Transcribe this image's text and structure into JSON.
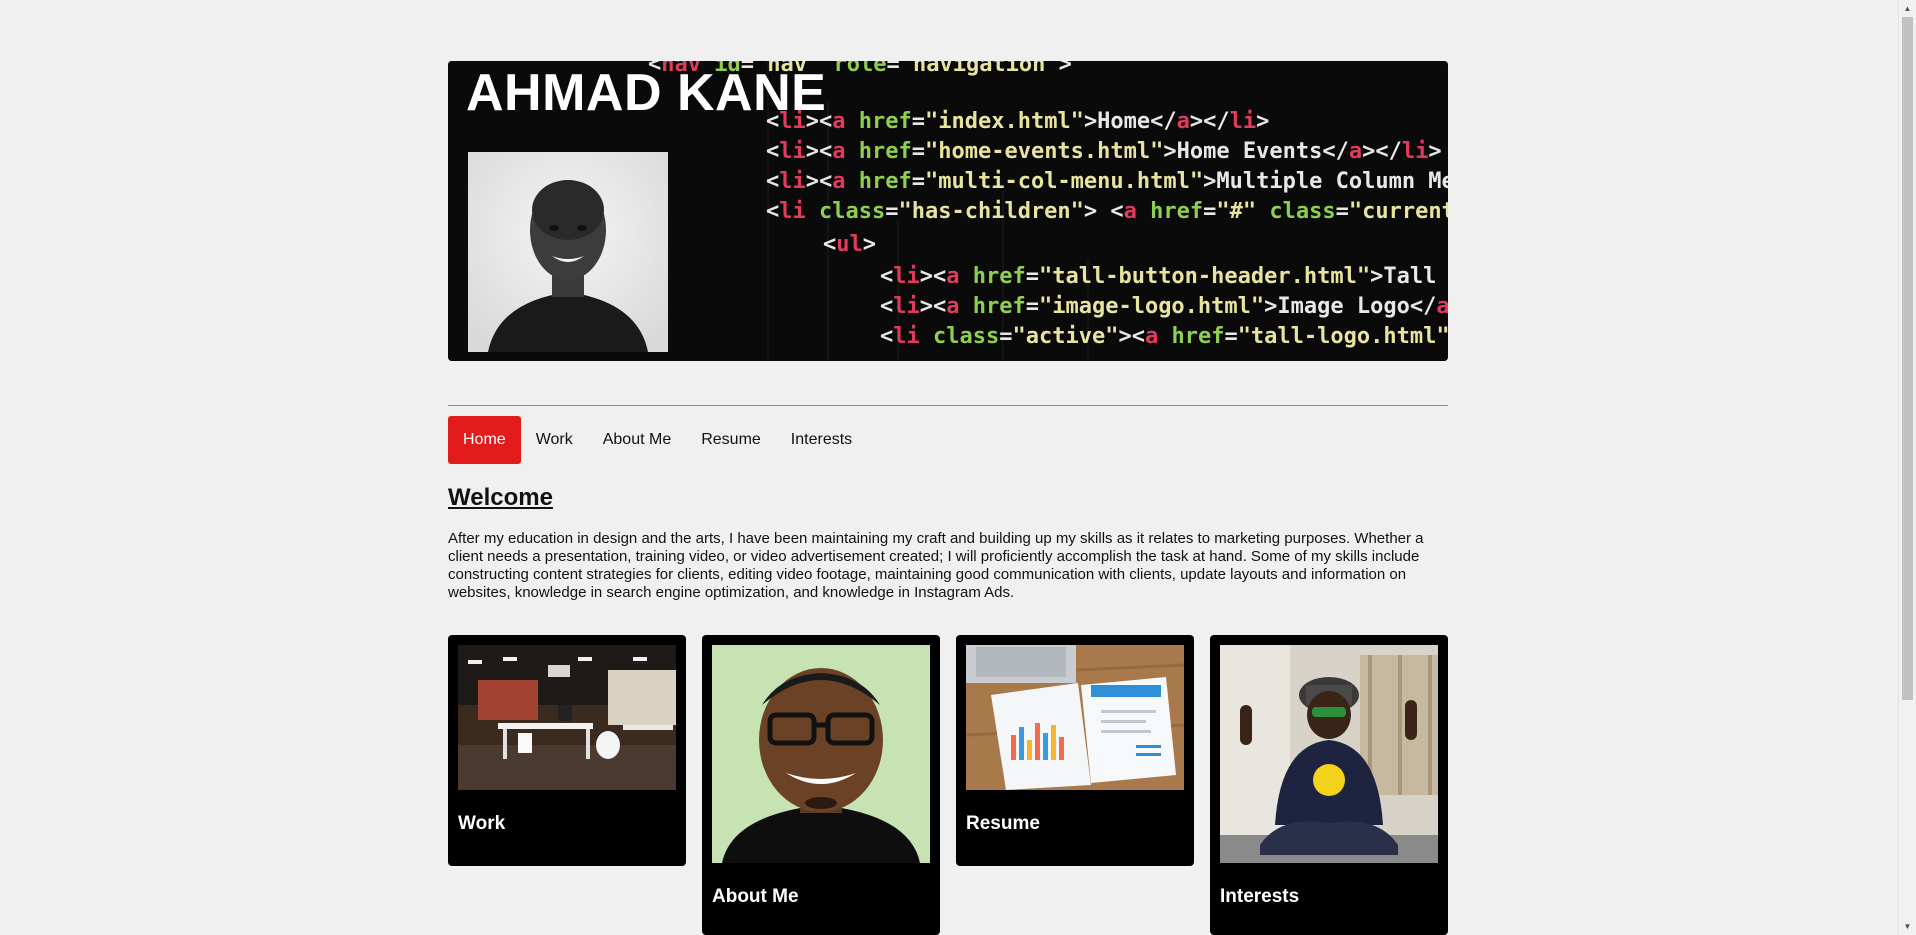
{
  "header": {
    "name": "AHMAD KANE",
    "code_lines": [
      "<nav id=\"nav\" role=\"navigation\">",
      "<li><a href=\"index.html\">Home</a></li>",
      "<li><a href=\"home-events.html\">Home Events</a></li>",
      "<li><a href=\"multi-col-menu.html\">Multiple Column Menu",
      "<li class=\"has-children\"> <a href=\"#\" class=\"current\">",
      "<ul>",
      "<li><a href=\"tall-button-header.html\">Tall But",
      "<li><a href=\"image-logo.html\">Image Logo</a></",
      "<li class=\"active\"><a href=\"tall-logo.html\">Ta"
    ]
  },
  "nav": {
    "items": [
      {
        "label": "Home",
        "active": true
      },
      {
        "label": "Work",
        "active": false
      },
      {
        "label": "About Me",
        "active": false
      },
      {
        "label": "Resume",
        "active": false
      },
      {
        "label": "Interests",
        "active": false
      }
    ]
  },
  "welcome": {
    "title": "Welcome",
    "body": "After my education in design and the arts, I have been maintaining my craft and building up my skills as it relates to marketing purposes. Whether a client needs a presentation, training video, or video advertisement created; I will proficiently accomplish the task at hand. Some of my skills include constructing content strategies for clients, editing video footage, maintaining good communication with clients, update layouts and information on websites, knowledge in search engine optimization, and knowledge in Instagram Ads."
  },
  "cards": [
    {
      "title": "Work"
    },
    {
      "title": "About Me"
    },
    {
      "title": "Resume"
    },
    {
      "title": "Interests"
    }
  ],
  "colors": {
    "accent": "#e31b1b",
    "page_bg": "#f0f0f0",
    "card_bg": "#000000"
  }
}
